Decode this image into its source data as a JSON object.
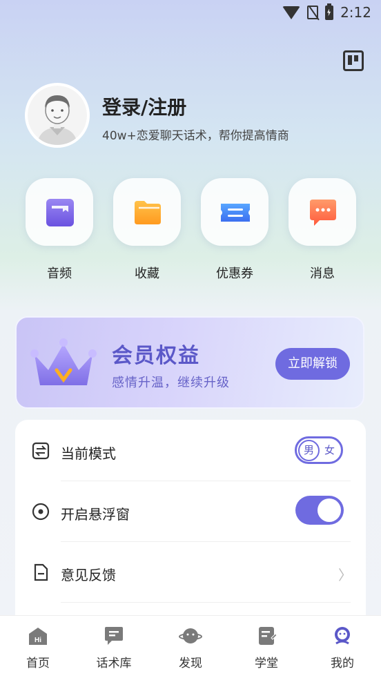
{
  "status": {
    "time": "2:12"
  },
  "profile": {
    "title": "登录/注册",
    "subtitle": "40w+恋爱聊天话术，帮你提高情商"
  },
  "quick_actions": [
    {
      "label": "音频",
      "icon": "audio-book-icon"
    },
    {
      "label": "收藏",
      "icon": "folder-icon"
    },
    {
      "label": "优惠券",
      "icon": "coupon-icon"
    },
    {
      "label": "消息",
      "icon": "message-icon"
    }
  ],
  "vip": {
    "title": "会员权益",
    "subtitle": "感情升温，继续升级",
    "button": "立即解锁"
  },
  "settings": {
    "mode_label": "当前模式",
    "gender_options": [
      "男",
      "女"
    ],
    "float_label": "开启悬浮窗",
    "float_enabled": true,
    "feedback_label": "意见反馈",
    "chevron": "〉"
  },
  "nav": [
    {
      "label": "首页",
      "icon": "home-icon",
      "badge": "Hi"
    },
    {
      "label": "话术库",
      "icon": "chat-library-icon"
    },
    {
      "label": "发现",
      "icon": "planet-icon"
    },
    {
      "label": "学堂",
      "icon": "notebook-icon"
    },
    {
      "label": "我的",
      "icon": "profile-icon"
    }
  ],
  "colors": {
    "accent": "#6f6be0",
    "vip_text": "#5b58c8"
  }
}
